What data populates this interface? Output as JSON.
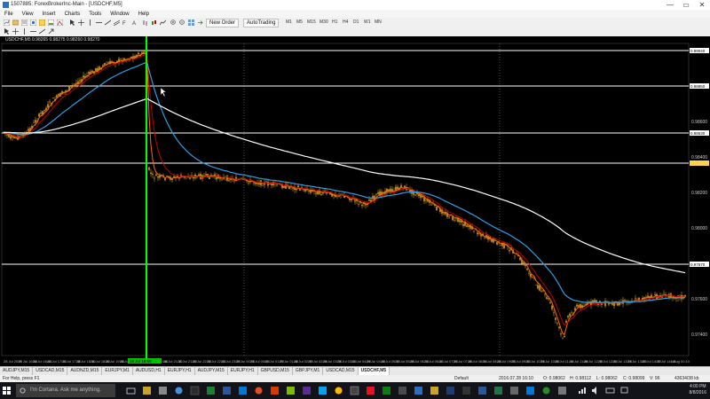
{
  "window": {
    "title": "1507885: ForexBrokerInc-Main - [USDCHF,M5]",
    "controls": [
      "—",
      "▭",
      "✕"
    ]
  },
  "menu": [
    "File",
    "View",
    "Insert",
    "Charts",
    "Tools",
    "Window",
    "Help"
  ],
  "toolbar": {
    "new_order": "New Order",
    "autotrading": "AutoTrading",
    "timeframes": [
      "M1",
      "M5",
      "M15",
      "M30",
      "H1",
      "H4",
      "D1",
      "W1",
      "MN"
    ]
  },
  "chart": {
    "header": "USDCHF,M5  0.98265 0.98275 0.98260 0.98270",
    "price_labels": [
      "0.99000",
      "0.98800",
      "0.98600",
      "0.98400",
      "0.98200",
      "0.98000",
      "0.97800",
      "0.97600",
      "0.97400"
    ],
    "highlight_labels": [
      "0.99040",
      "0.98850",
      "0.98530",
      "0.98360",
      "0.97570"
    ],
    "time_labels": [
      "28 Jul 2016",
      "28 Jul 16:10",
      "28 Jul 16:40",
      "28 Jul 17:10",
      "28 Jul 17:40",
      "28 Jul 18:10",
      "28 Jul 18:40",
      "28 Jul 19:10",
      "28 Jul 19:40",
      "28 Jul 20:10",
      "28 Jul 20:40",
      "28 Jul 21:10",
      "28 Jul 21:40",
      "28 Jul 22:10",
      "28 Jul 22:40",
      "28 Jul 23:10",
      "29 Jul 00:10",
      "29 Jul 00:40",
      "29 Jul 01:10",
      "29 Jul 01:40",
      "29 Jul 02:10",
      "29 Jul 02:40",
      "29 Jul 03:10",
      "29 Jul 03:40",
      "29 Jul 04:10",
      "29 Jul 04:40",
      "29 Jul 05:10",
      "29 Jul 05:40",
      "29 Jul 06:10",
      "29 Jul 06:40",
      "29 Jul 07:10",
      "29 Jul 07:40",
      "29 Jul 08:10",
      "29 Jul 08:40",
      "29 Jul 09:10",
      "29 Jul 09:40",
      "29 Jul 10:10",
      "29 Jul 10:40",
      "29 Jul 11:10",
      "29 Jul 11:40",
      "29 Jul 12:10",
      "29 Jul 12:40",
      "29 Jul 13:10",
      "29 Jul 13:40",
      "29 Jul 14:10",
      "29 Jul 14:40",
      "1 Aug 00:10"
    ],
    "cursor_time": "28 Jul 18:50"
  },
  "chart_tabs": [
    "AUDJPY,M15",
    "USDCAD,M15",
    "AUDNZD,M15",
    "EURJPY,M1",
    "AUDUSD,H1",
    "EURJPY,H1",
    "AUDJPY,M15",
    "EURJPY,H1",
    "GBPUSD,M15",
    "GBPJPY,M1",
    "USDCAD,M15",
    "USDCHF,M5"
  ],
  "active_tab": "USDCHF,M5",
  "status": {
    "help": "For Help, press F1",
    "profile": "Default",
    "datetime": "2016.07.28 16:10",
    "open": "O: 0.98062",
    "high": "H: 0.98112",
    "low": "L: 0.98062",
    "close": "C: 0.98099",
    "volume": "V: 96",
    "traffic": "43634/38 kb"
  },
  "taskbar": {
    "search_placeholder": "I'm Cortana. Ask me anything.",
    "time": "4:00 PM",
    "date": "8/8/2016"
  },
  "colors": {
    "chart_bg": "#000000",
    "candle": "#d9a020",
    "fast_ma": "#ff6a00",
    "mid_ma": "#c00000",
    "slow_ma": "#2e9ee6",
    "long_ma": "#ffffff",
    "vline": "#00ff00"
  }
}
